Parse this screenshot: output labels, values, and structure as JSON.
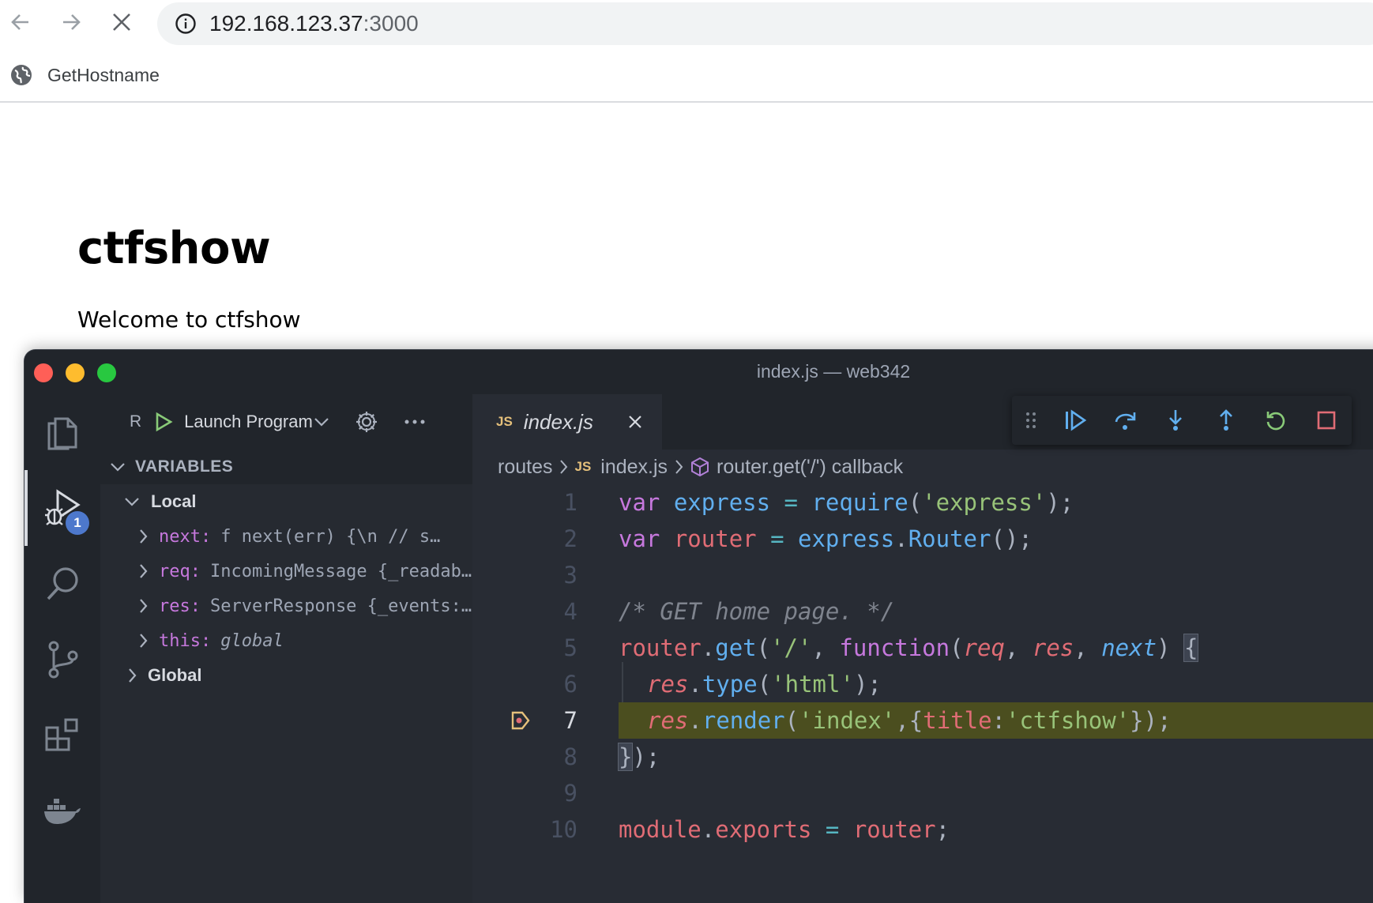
{
  "browser": {
    "url_host": "192.168.123.37",
    "url_port": ":3000",
    "bookmark_label": "GetHostname"
  },
  "page": {
    "heading": "ctfshow",
    "text": "Welcome to ctfshow"
  },
  "vscode": {
    "window_title": "index.js — web342",
    "debug_config_letter": "R",
    "debug_config": "Launch Program",
    "variables_title": "VARIABLES",
    "scope_local": "Local",
    "scope_global": "Global",
    "variables": [
      {
        "name": "next",
        "value": "f next(err) {\\n    // s…",
        "italic": false
      },
      {
        "name": "req",
        "value": "IncomingMessage {_readab…",
        "italic": false
      },
      {
        "name": "res",
        "value": "ServerResponse {_events:…",
        "italic": false
      },
      {
        "name": "this",
        "value": "global",
        "italic": true
      }
    ],
    "debug_badge": "1",
    "tab": {
      "icon": "JS",
      "label": "index.js"
    },
    "breadcrumbs": {
      "folder": "routes",
      "file_icon": "JS",
      "file": "index.js",
      "symbol": "router.get('/') callback"
    },
    "line_numbers": [
      "1",
      "2",
      "3",
      "4",
      "5",
      "6",
      "7",
      "8",
      "9",
      "10"
    ],
    "code_lines": {
      "l1": {
        "a": "var",
        "b": " express ",
        "c": "=",
        "d": " ",
        "e": "require",
        "f": "(",
        "g": "'express'",
        "h": ");"
      },
      "l2": {
        "a": "var",
        "b": " router ",
        "c": "=",
        "d": " express",
        "e": ".",
        "f": "Router",
        "g": "();"
      },
      "l4": {
        "a": "/* GET home page. */"
      },
      "l5": {
        "a": "router",
        "b": ".",
        "c": "get",
        "d": "(",
        "e": "'/'",
        "f": ", ",
        "g": "function",
        "h": "(",
        "i": "req",
        "j": ", ",
        "k": "res",
        "l": ", ",
        "m": "next",
        "n": ") ",
        "o": "{"
      },
      "l6": {
        "a": "res",
        "b": ".",
        "c": "type",
        "d": "(",
        "e": "'html'",
        "f": ");"
      },
      "l7": {
        "a": "res",
        "b": ".",
        "c": "render",
        "d": "(",
        "e": "'index'",
        "f": ",{",
        "g": "title",
        "h": ":",
        "i": "'ctfshow'",
        "j": "});"
      },
      "l8": {
        "a": "}",
        "b": ");"
      },
      "l10": {
        "a": "module",
        "b": ".",
        "c": "exports",
        "d": " = ",
        "e": "router",
        "f": ";"
      }
    },
    "colors": {
      "keyword": "#c678dd",
      "function": "#61afef",
      "string": "#98c379",
      "variable": "#e06c75",
      "current_line": "#4b4e1f"
    }
  }
}
